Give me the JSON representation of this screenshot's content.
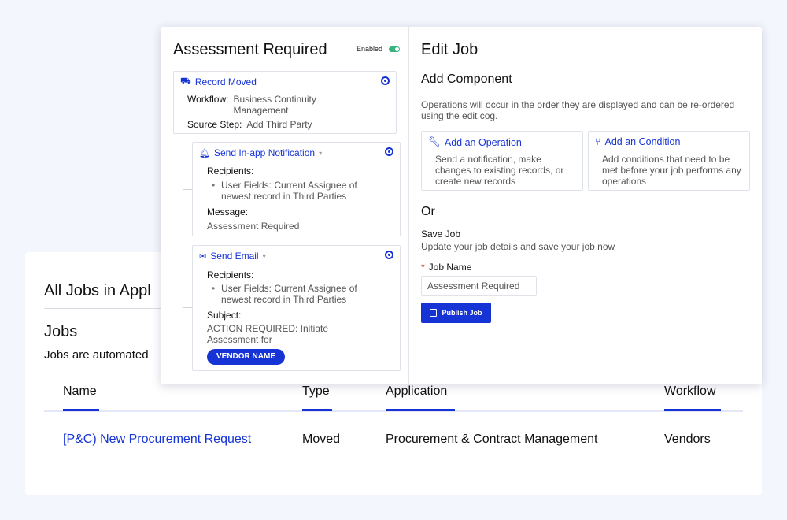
{
  "jobs_page": {
    "breadcrumb": "All Jobs in Appl",
    "title": "Jobs",
    "description": "Jobs are automated",
    "columns": [
      "Name",
      "Type",
      "Application",
      "Workflow"
    ],
    "rows": [
      {
        "name": "[P&C) New Procurement Request",
        "type": "Moved",
        "application": "Procurement & Contract Management",
        "workflow": "Vendors"
      }
    ]
  },
  "modal": {
    "left": {
      "title": "Assessment Required",
      "enabled_label": "Enabled",
      "trigger": {
        "label": "Record Moved",
        "workflow_label": "Workflow:",
        "workflow_value_1": "Business Continuity",
        "workflow_value_2": "Management",
        "source_label": "Source Step:",
        "source_value": "Add Third Party"
      },
      "notification": {
        "label": "Send In-app Notification",
        "recipients_label": "Recipients:",
        "recipient_1": "User Fields: Current Assignee of",
        "recipient_2": "newest record in Third Parties",
        "message_label": "Message:",
        "message_value": "Assessment Required"
      },
      "email": {
        "label": "Send Email",
        "recipients_label": "Recipients:",
        "recipient_1": "User Fields: Current Assignee of",
        "recipient_2": "newest record in Third Parties",
        "subject_label": "Subject:",
        "subject_1": "ACTION REQUIRED: Initiate",
        "subject_2": "Assessment for",
        "vendor_chip": "VENDOR NAME"
      }
    },
    "right": {
      "title": "Edit Job",
      "subtitle": "Add Component",
      "description": "Operations will occur in the order they are displayed and can be re-ordered using the edit cog.",
      "operation": {
        "label": "Add an Operation",
        "body": "Send a notification, make changes to existing records, or create new records"
      },
      "condition": {
        "label": "Add an Condition",
        "body": "Add conditions that need to be met before your job performs any operations"
      },
      "or_label": "Or",
      "save_title": "Save Job",
      "save_desc": "Update your job details and save your job now",
      "job_name_label": "Job Name",
      "job_name_required": "*",
      "job_name_value": "Assessment Required",
      "publish_label": "Publish Job"
    }
  },
  "colors": {
    "accent": "#1634d6",
    "toggle_on": "#36b37e",
    "background": "#f4f6fd"
  }
}
